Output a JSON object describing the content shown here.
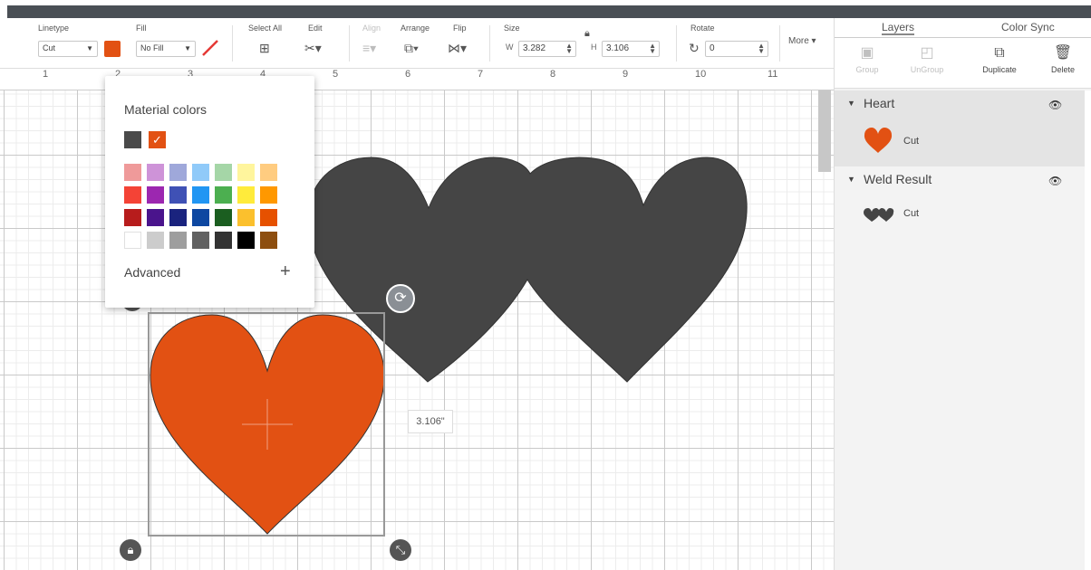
{
  "toolbar": {
    "linetype_label": "Linetype",
    "linetype_value": "Cut",
    "fill_label": "Fill",
    "fill_value": "No Fill",
    "select_all_label": "Select All",
    "edit_label": "Edit",
    "align_label": "Align",
    "arrange_label": "Arrange",
    "flip_label": "Flip",
    "size_label": "Size",
    "w_label": "W",
    "w_value": "3.282",
    "h_label": "H",
    "h_value": "3.106",
    "rotate_label": "Rotate",
    "rotate_value": "0",
    "more_label": "More ▾",
    "accent_color": "#e25113"
  },
  "ruler": [
    "1",
    "2",
    "3",
    "4",
    "5",
    "6",
    "7",
    "8",
    "9",
    "10",
    "11"
  ],
  "popup": {
    "title": "Material colors",
    "advanced_label": "Advanced",
    "plus": "+",
    "selected_colors": [
      "#4a4a4a",
      "#e25113"
    ],
    "palette": [
      [
        "#ef9a9a",
        "#ce93d8",
        "#9fa8da",
        "#90caf9",
        "#a5d6a7",
        "#fff59d",
        "#ffcc80"
      ],
      [
        "#f44336",
        "#9c27b0",
        "#3f51b5",
        "#2196f3",
        "#4caf50",
        "#ffeb3b",
        "#ff9800"
      ],
      [
        "#b71c1c",
        "#4a148c",
        "#1a237e",
        "#0d47a1",
        "#1b5e20",
        "#fbc02d",
        "#e65100"
      ],
      [
        "#ffffff",
        "#cccccc",
        "#9e9e9e",
        "#616161",
        "#333333",
        "#000000",
        "#8d4e0f"
      ]
    ]
  },
  "canvas": {
    "dimension_label": "3.106\"",
    "heart_fill": "#e25113",
    "weld_fill": "#454545"
  },
  "panel": {
    "tabs": [
      "Layers",
      "Color Sync"
    ],
    "actions": [
      "Group",
      "UnGroup",
      "Duplicate",
      "Delete"
    ],
    "layers": [
      {
        "name": "Heart",
        "item": "Cut"
      },
      {
        "name": "Weld Result",
        "item": "Cut"
      }
    ]
  }
}
